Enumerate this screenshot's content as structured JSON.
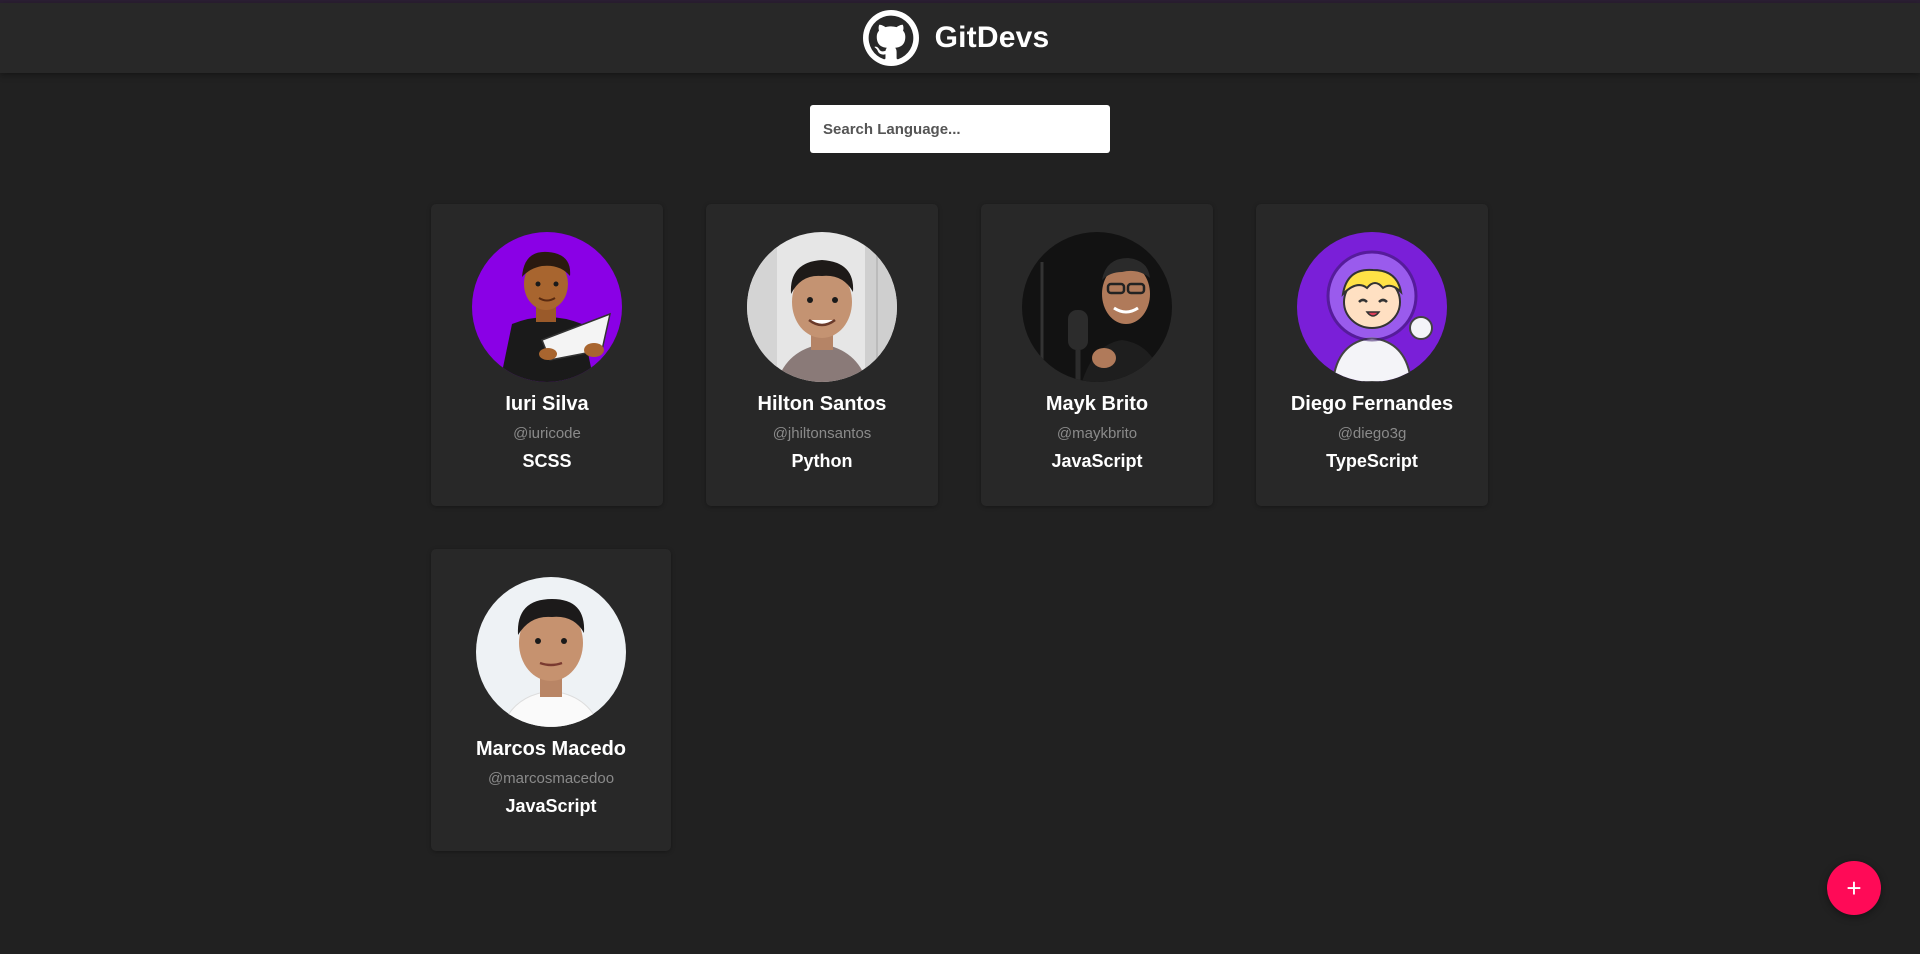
{
  "header": {
    "title": "GitDevs",
    "logo_icon": "github-icon"
  },
  "search": {
    "placeholder": "Search Language..."
  },
  "developers": [
    {
      "name": "Iuri Silva",
      "username": "@iuricode",
      "language": "SCSS",
      "avatar_bg": "#8a00e6"
    },
    {
      "name": "Hilton Santos",
      "username": "@jhiltonsantos",
      "language": "Python",
      "avatar_bg": "#e8e8e8"
    },
    {
      "name": "Mayk Brito",
      "username": "@maykbrito",
      "language": "JavaScript",
      "avatar_bg": "#111111"
    },
    {
      "name": "Diego Fernandes",
      "username": "@diego3g",
      "language": "TypeScript",
      "avatar_bg": "#7a1fd8"
    },
    {
      "name": "Marcos Macedo",
      "username": "@marcosmacedoo",
      "language": "JavaScript",
      "avatar_bg": "#eef2f5"
    }
  ],
  "fab": {
    "label": "+",
    "icon": "plus-icon"
  },
  "colors": {
    "background": "#212121",
    "header": "#282828",
    "card": "#282828",
    "accent": "#ff0a57"
  }
}
